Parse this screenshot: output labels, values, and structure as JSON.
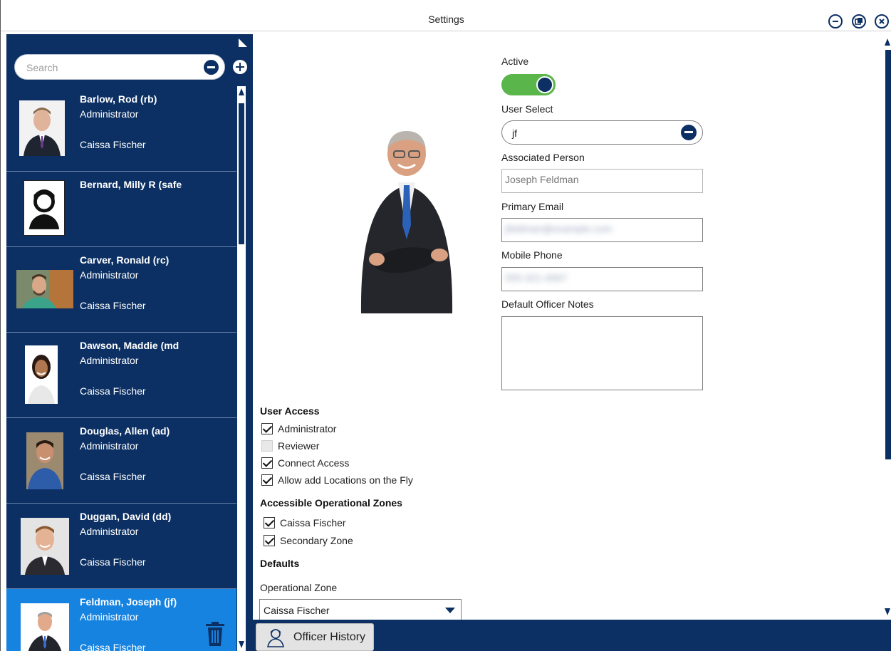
{
  "window": {
    "title": "Settings",
    "controls": [
      "minimize-icon",
      "restore-icon",
      "close-icon"
    ]
  },
  "sidebar": {
    "search_placeholder": "Search",
    "users": [
      {
        "name": "Barlow, Rod (rb)",
        "role": "Administrator",
        "zone": "Caissa Fischer",
        "avatar": "photo-man-suit",
        "selected": false
      },
      {
        "name": "Bernard, Milly R (safe",
        "role": "",
        "zone": "",
        "avatar": "generic-person-icon",
        "selected": false
      },
      {
        "name": "Carver, Ronald (rc)",
        "role": "Administrator",
        "zone": "Caissa Fischer",
        "avatar": "photo-man-beard",
        "selected": false
      },
      {
        "name": "Dawson, Maddie (md",
        "role": "Administrator",
        "zone": "Caissa Fischer",
        "avatar": "photo-woman",
        "selected": false
      },
      {
        "name": "Douglas, Allen (ad)",
        "role": "Administrator",
        "zone": "Caissa Fischer",
        "avatar": "photo-man-smiling",
        "selected": false
      },
      {
        "name": "Duggan, David (dd)",
        "role": "Administrator",
        "zone": "Caissa Fischer",
        "avatar": "photo-man-young",
        "selected": false
      },
      {
        "name": "Feldman, Joseph (jf)",
        "role": "Administrator",
        "zone": "Caissa Fischer",
        "avatar": "photo-man-gray",
        "selected": true
      }
    ]
  },
  "form": {
    "active_label": "Active",
    "active_on": true,
    "user_select_label": "User Select",
    "user_select_value": "jf",
    "associated_person_label": "Associated Person",
    "associated_person_value": "Joseph Feldman",
    "primary_email_label": "Primary Email",
    "primary_email_value": "jfeldman@example.com",
    "mobile_phone_label": "Mobile Phone",
    "mobile_phone_value": "555-321-4567",
    "notes_label": "Default Officer Notes",
    "notes_value": ""
  },
  "user_access": {
    "heading": "User Access",
    "options": [
      {
        "label": "Administrator",
        "checked": true,
        "enabled": true
      },
      {
        "label": "Reviewer",
        "checked": false,
        "enabled": false
      },
      {
        "label": "Connect Access",
        "checked": true,
        "enabled": true
      },
      {
        "label": "Allow add Locations on the Fly",
        "checked": true,
        "enabled": true
      }
    ]
  },
  "zones": {
    "heading": "Accessible Operational Zones",
    "options": [
      {
        "label": "Caissa Fischer",
        "checked": true
      },
      {
        "label": "Secondary Zone",
        "checked": true
      }
    ]
  },
  "defaults": {
    "heading": "Defaults",
    "operational_zone_label": "Operational Zone",
    "operational_zone_value": "Caissa Fischer"
  },
  "footer": {
    "officer_history_label": "Officer History"
  },
  "colors": {
    "navy": "#0c3063",
    "selected": "#1683e0",
    "toggle_on": "#5ab54a"
  }
}
